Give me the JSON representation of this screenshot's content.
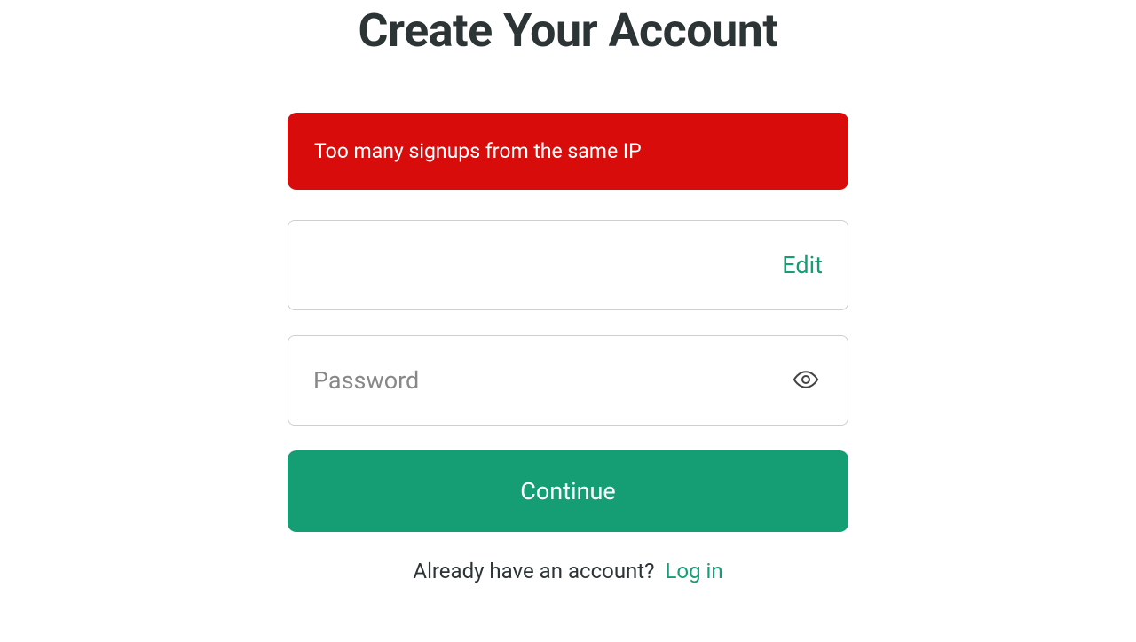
{
  "title": "Create Your Account",
  "error_message": "Too many signups from the same IP",
  "email_field": {
    "edit_label": "Edit"
  },
  "password_field": {
    "placeholder": "Password"
  },
  "continue_button": "Continue",
  "footer": {
    "prompt": "Already have an account?",
    "login_link": "Log in"
  }
}
